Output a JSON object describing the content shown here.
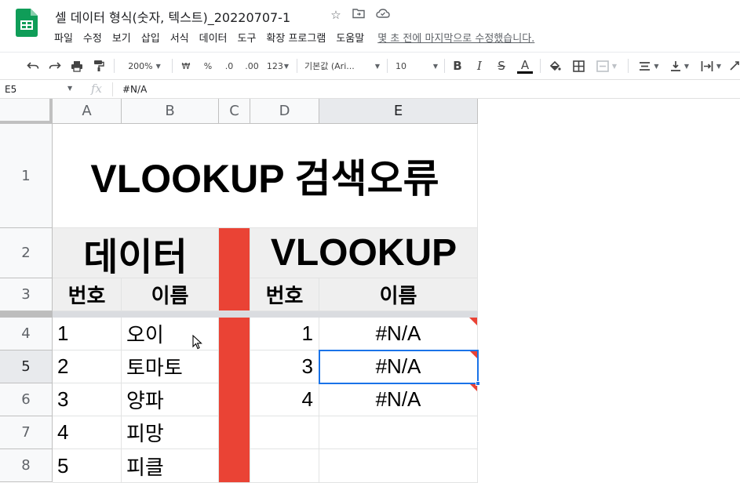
{
  "document": {
    "title": "셀 데이터 형식(숫자, 텍스트)_20220707-1",
    "last_edit": "몇 초 전에 마지막으로 수정했습니다."
  },
  "menu": [
    "파일",
    "수정",
    "보기",
    "삽입",
    "서식",
    "데이터",
    "도구",
    "확장 프로그램",
    "도움말"
  ],
  "toolbar": {
    "zoom": "200%",
    "currency": "₩",
    "percent": "%",
    "decrease_decimal": ".0",
    "increase_decimal": ".00",
    "more_formats": "123",
    "font": "기본값 (Ari...",
    "font_size": "10",
    "bold": "B",
    "italic": "I",
    "strike": "S",
    "text_color": "A"
  },
  "formula_bar": {
    "name_box": "E5",
    "fx": "fx",
    "value": "#N/A"
  },
  "columns": [
    "A",
    "B",
    "C",
    "D",
    "E"
  ],
  "rows": [
    "1",
    "2",
    "3",
    "4",
    "5",
    "6",
    "7",
    "8"
  ],
  "sheet": {
    "title": "VLOOKUP 검색오류",
    "left_header": "데이터",
    "right_header": "VLOOKUP",
    "sub_headers": {
      "a": "번호",
      "b": "이름",
      "d": "번호",
      "e": "이름"
    },
    "data_rows": [
      {
        "no": "1",
        "name": "오이"
      },
      {
        "no": "2",
        "name": "토마토"
      },
      {
        "no": "3",
        "name": "양파"
      },
      {
        "no": "4",
        "name": "피망"
      },
      {
        "no": "5",
        "name": "피클"
      }
    ],
    "lookup_rows": [
      {
        "no": "1",
        "result": "#N/A"
      },
      {
        "no": "3",
        "result": "#N/A"
      },
      {
        "no": "4",
        "result": "#N/A"
      }
    ]
  },
  "colors": {
    "accent_red": "#ea4335",
    "selection_blue": "#1a73e8",
    "header_fill": "#efefef",
    "sheets_green": "#0f9d58"
  }
}
